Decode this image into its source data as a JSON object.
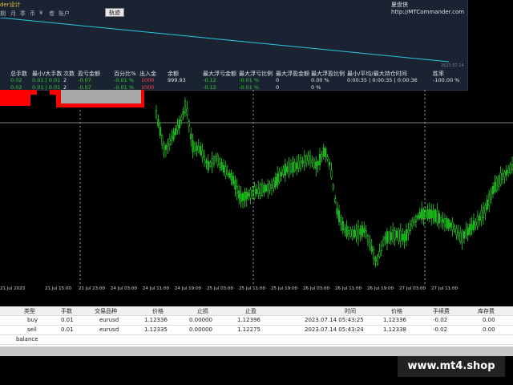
{
  "window": {
    "title": "der设计",
    "brand": "夏盘侠 http://MTCommander.com"
  },
  "menu": [
    "期",
    "月",
    "季",
    "币",
    "¥",
    "卷",
    "账户"
  ],
  "trend_button": "轨迹",
  "mini_chart": {
    "date_label": "2023.07.14"
  },
  "stats": {
    "headers": [
      "总手数",
      "最小/大手数",
      "次数",
      "盈亏金额",
      "百分比%",
      "出入金",
      "余额",
      "最大浮亏金额",
      "最大浮亏比例",
      "最大浮盈金额",
      "最大浮盈比例",
      "最小/平均/最大持仓时间",
      "胜率"
    ],
    "row1": [
      "0.02",
      "0.01 | 0.01",
      "2",
      "-0.07",
      "-0.01 %",
      "1000",
      "999.93",
      "-0.12",
      "-0.01 %",
      "0",
      "0.00 %",
      "0:00:35 | 0:00:35 | 0:00:36",
      "-100.00 %"
    ],
    "row2": [
      "0.02",
      "0.01 | 0.01",
      "2",
      "-0.07",
      "-0.01 %",
      "1000",
      "",
      "-0.12",
      "-0.01 %",
      "0",
      "0 %",
      "",
      ""
    ]
  },
  "x_axis": [
    "21 Jul 2023",
    "21 Jul 15:00",
    "21 Jul 23:00",
    "24 Jul 03:00",
    "24 Jul 11:00",
    "24 Jul 19:00",
    "25 Jul 03:00",
    "25 Jul 11:00",
    "25 Jul 19:00",
    "26 Jul 03:00",
    "26 Jul 11:00",
    "26 Jul 19:00",
    "27 Jul 03:00",
    "27 Jul 11:00"
  ],
  "orders": {
    "headers": [
      "类型",
      "手数",
      "交易品种",
      "价格",
      "止损",
      "止盈",
      "时间",
      "价格",
      "手续费",
      "库存费"
    ],
    "rows": [
      [
        "buy",
        "0.01",
        "eurusd",
        "1.12336",
        "0.00000",
        "1.12396",
        "2023.07.14 05:43:25",
        "1.12336",
        "-0.02",
        "0.00"
      ],
      [
        "sell",
        "0.01",
        "eurusd",
        "1.12335",
        "0.00000",
        "1.12275",
        "2023.07.14 05:43:24",
        "1.12338",
        "-0.02",
        "0.00"
      ]
    ],
    "balance_label": "balance"
  },
  "watermark": "www.mt4.shop",
  "colors": {
    "panel_bg": "#1a2332",
    "line": "#28c8e0",
    "bull": "#2ed02e",
    "bear": "#ff0000",
    "candle_fill": "#00aa00"
  }
}
